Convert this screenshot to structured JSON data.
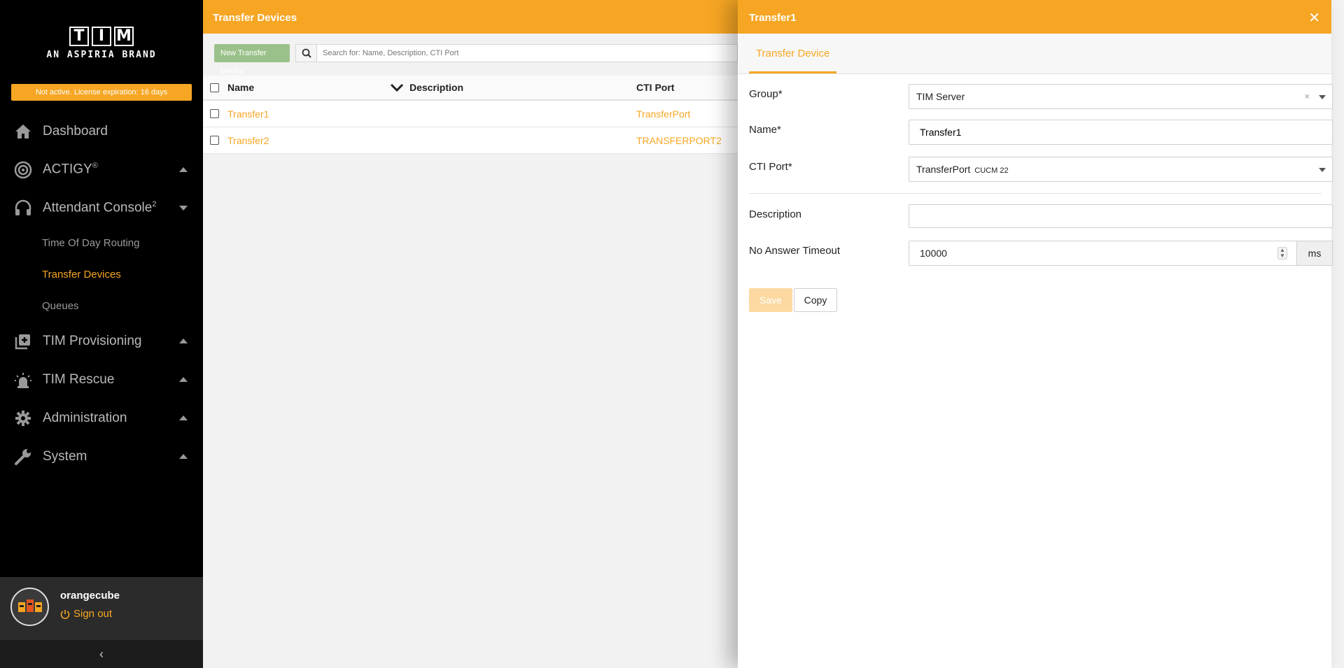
{
  "brand": {
    "logo_letters": [
      "T",
      "I",
      "M"
    ],
    "logo_subtitle": "AN ASPIRIA BRAND",
    "license_notice": "Not active. License expiration: 16 days"
  },
  "sidebar": {
    "items": [
      {
        "label": "Dashboard",
        "icon": "home-icon"
      },
      {
        "label": "ACTIGY",
        "sup": "®",
        "icon": "actigy-icon",
        "caret": "up"
      },
      {
        "label": "Attendant Console",
        "sup": "2",
        "icon": "headset-icon",
        "caret": "down"
      },
      {
        "label": "TIM Provisioning",
        "icon": "provisioning-icon",
        "caret": "up"
      },
      {
        "label": "TIM Rescue",
        "icon": "alarm-icon",
        "caret": "up"
      },
      {
        "label": "Administration",
        "icon": "gear-icon",
        "caret": "up"
      },
      {
        "label": "System",
        "icon": "wrench-icon",
        "caret": "up"
      }
    ],
    "sub_items": [
      "Time Of Day Routing",
      "Transfer Devices",
      "Queues"
    ],
    "active_sub_item": "Transfer Devices"
  },
  "user": {
    "name": "orangecube",
    "signout_label": "Sign out"
  },
  "list": {
    "title": "Transfer Devices",
    "new_button_label": "New Transfer Device",
    "search_placeholder": "Search for: Name, Description, CTI Port",
    "columns": {
      "name": "Name",
      "description": "Description",
      "cti_port": "CTI Port"
    },
    "rows": [
      {
        "name": "Transfer1",
        "description": "",
        "cti_port": "TransferPort"
      },
      {
        "name": "Transfer2",
        "description": "",
        "cti_port": "TRANSFERPORT2"
      }
    ]
  },
  "detail": {
    "title": "Transfer1",
    "tab_label": "Transfer Device",
    "fields": {
      "group": {
        "label": "Group*",
        "value": "TIM Server"
      },
      "name": {
        "label": "Name*",
        "value": "Transfer1"
      },
      "cti_port": {
        "label": "CTI Port*",
        "value": "TransferPort",
        "tag": "CUCM 22"
      },
      "description": {
        "label": "Description",
        "value": ""
      },
      "timeout": {
        "label": "No Answer Timeout",
        "value": "10000",
        "unit": "ms"
      }
    },
    "save_label": "Save",
    "copy_label": "Copy"
  },
  "colors": {
    "accent": "#f6a623",
    "sidebar_bg": "#000000",
    "new_button": "#9bc18b"
  }
}
